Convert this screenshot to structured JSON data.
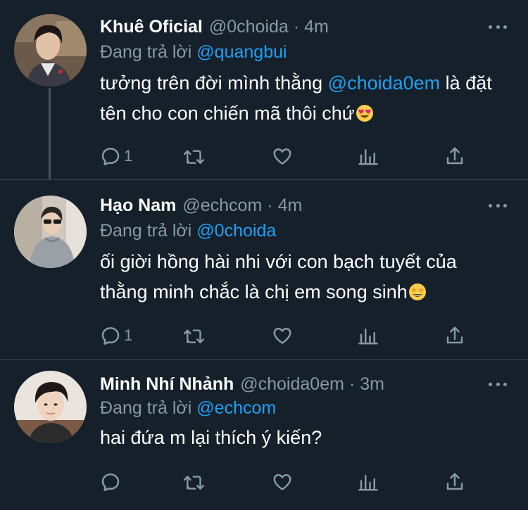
{
  "reply_prefix": "Đang trả lời",
  "tweets": [
    {
      "name": "Khuê Oficial",
      "handle": "@0choida",
      "separator": "·",
      "time": "4m",
      "reply_to": "@quangbui",
      "text_before": "tưởng trên đời mình thằng ",
      "text_mention": "@choida0em",
      "text_after": " là đặt tên cho con chiến mã thôi chứ",
      "emoji": "heart-eyes-emoji",
      "reply_count": "1",
      "avatar": "profile-photo"
    },
    {
      "name": "Hạo Nam",
      "handle": "@echcom",
      "separator": "·",
      "time": "4m",
      "reply_to": "@0choida",
      "text_before": "ối giời hồng hài nhi với con bạch tuyết của thằng minh chắc là chị em song sinh",
      "emoji": "star-struck-emoji",
      "reply_count": "1",
      "avatar": "profile-photo"
    },
    {
      "name": "Minh Nhí Nhảnh",
      "handle": "@choida0em",
      "separator": "·",
      "time": "3m",
      "reply_to": "@echcom",
      "text_before": "hai đứa m lại thích ý kiến?",
      "reply_count": "",
      "avatar": "profile-photo"
    }
  ],
  "icons": {
    "reply": "reply-icon",
    "retweet": "retweet-icon",
    "like": "heart-icon",
    "stats": "analytics-icon",
    "share": "share-icon",
    "more": "more-icon"
  },
  "colors": {
    "background": "#15202b",
    "link": "#1da1f2",
    "muted": "#8899a6",
    "divider": "#38444d"
  }
}
